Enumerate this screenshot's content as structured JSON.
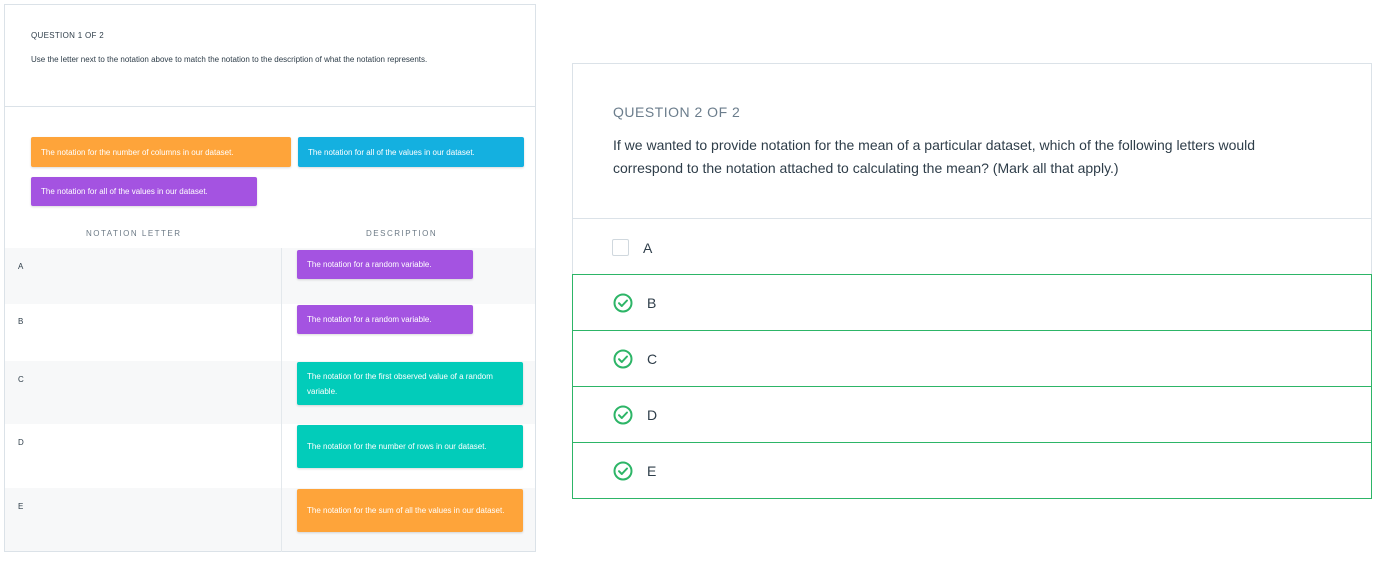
{
  "question1": {
    "label": "QUESTION 1 OF 2",
    "prompt": "Use the letter next to the notation above to match the notation to the description of what the notation represents.",
    "chips": [
      {
        "text": "The notation for the number of columns in our dataset.",
        "color": "#fea43a"
      },
      {
        "text": "The notation for all of the values in our dataset.",
        "color": "#14b0e0"
      },
      {
        "text": "The notation for all of the values in our dataset.",
        "color": "#a453e1"
      }
    ],
    "column_headers": {
      "letter": "NOTATION LETTER",
      "description": "DESCRIPTION"
    },
    "rows": [
      {
        "letter": "A",
        "description": "The notation for a random variable.",
        "color": "#a453e1"
      },
      {
        "letter": "B",
        "description": "The notation for a random variable.",
        "color": "#a453e1"
      },
      {
        "letter": "C",
        "description": "The notation for the first observed value of a random variable.",
        "color": "#02ccba"
      },
      {
        "letter": "D",
        "description": "The notation for the number of rows in our dataset.",
        "color": "#02ccba"
      },
      {
        "letter": "E",
        "description": "The notation for the sum of all the values in our dataset.",
        "color": "#fea43a"
      }
    ]
  },
  "question2": {
    "label": "QUESTION 2 OF 2",
    "prompt": "If we wanted to provide notation for the mean of a particular dataset, which of the following letters would correspond to the notation attached to calculating the mean? (Mark all that apply.)",
    "options": [
      {
        "letter": "A",
        "selected": false
      },
      {
        "letter": "B",
        "selected": true
      },
      {
        "letter": "C",
        "selected": true
      },
      {
        "letter": "D",
        "selected": true
      },
      {
        "letter": "E",
        "selected": true
      }
    ],
    "accent_color": "#2db567"
  }
}
